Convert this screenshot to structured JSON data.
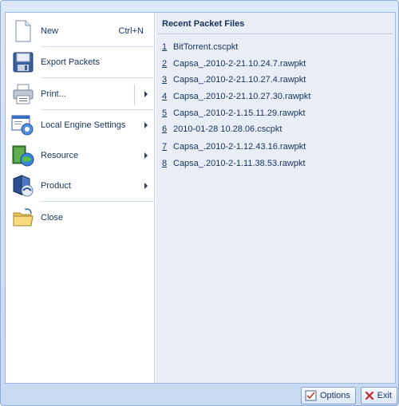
{
  "menu": {
    "items": [
      {
        "name": "new",
        "label": "New",
        "shortcut": "Ctrl+N",
        "icon": "new-document-icon"
      },
      {
        "name": "export-packets",
        "label": "Export Packets",
        "icon": "save-disk-icon"
      },
      {
        "name": "print",
        "label": "Print...",
        "icon": "printer-icon",
        "submenu": true
      },
      {
        "name": "local-engine-settings",
        "label": "Local Engine Settings",
        "icon": "settings-window-icon",
        "submenu": true
      },
      {
        "name": "resource",
        "label": "Resource",
        "icon": "book-globe-icon",
        "submenu": true
      },
      {
        "name": "product",
        "label": "Product",
        "icon": "product-box-icon",
        "submenu": true
      },
      {
        "name": "close",
        "label": "Close",
        "icon": "close-folder-icon"
      }
    ]
  },
  "recent": {
    "title": "Recent Packet Files",
    "files": [
      {
        "num": "1",
        "name": "BitTorrent.cscpkt"
      },
      {
        "num": "2",
        "name": "Capsa_.2010-2-21.10.24.7.rawpkt"
      },
      {
        "num": "3",
        "name": "Capsa_.2010-2-21.10.27.4.rawpkt"
      },
      {
        "num": "4",
        "name": "Capsa_.2010-2-21.10.27.30.rawpkt"
      },
      {
        "num": "5",
        "name": "Capsa_.2010-2-1.15.11.29.rawpkt"
      },
      {
        "num": "6",
        "name": "2010-01-28 10.28.06.cscpkt"
      },
      {
        "num": "7",
        "name": "Capsa_.2010-2-1.12.43.16.rawpkt"
      },
      {
        "num": "8",
        "name": "Capsa_.2010-2-1.11.38.53.rawpkt"
      }
    ]
  },
  "footer": {
    "options_label": "Options",
    "exit_label": "Exit"
  }
}
